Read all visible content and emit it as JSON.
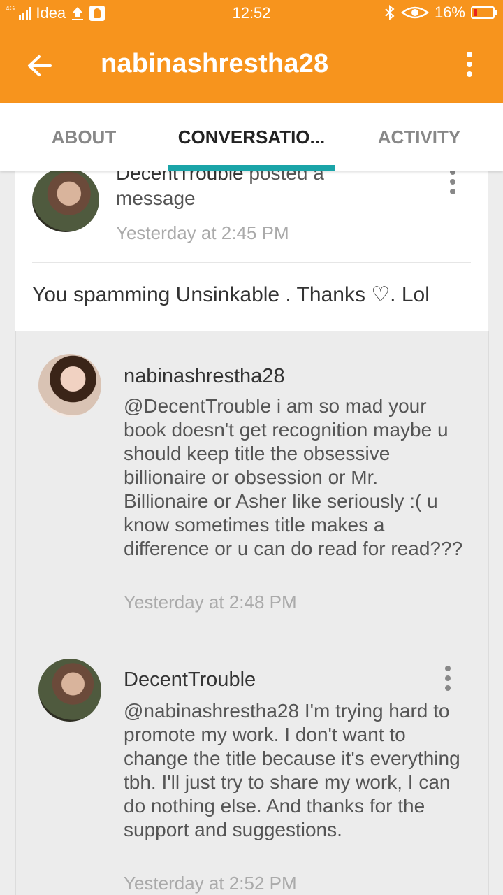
{
  "status_bar": {
    "network": "4G",
    "carrier": "Idea",
    "time": "12:52",
    "battery": "16%"
  },
  "app_bar": {
    "title": "nabinashrestha28"
  },
  "tabs": [
    {
      "label": "ABOUT",
      "active": false
    },
    {
      "label": "CONVERSATIO...",
      "active": true
    },
    {
      "label": "ACTIVITY",
      "active": false
    }
  ],
  "post": {
    "author": "DecentTrouble",
    "action": "posted a message",
    "timestamp": "Yesterday at 2:45 PM",
    "message": "You spamming Unsinkable . Thanks ♡. Lol"
  },
  "replies": [
    {
      "author": "nabinashrestha28",
      "body": "@DecentTrouble i am so mad your book doesn't get recognition maybe u should keep title the obsessive billionaire or obsession or Mr. Billionaire or Asher like seriously :( u know sometimes title makes a difference or u can do read for read???",
      "timestamp": "Yesterday at 2:48 PM"
    },
    {
      "author": "DecentTrouble",
      "body": "@nabinashrestha28 I'm trying hard to promote my work. I don't want to change the title because it's everything tbh. I'll just try to share my work, I can do nothing else. And thanks for the support and suggestions.",
      "timestamp": "Yesterday at 2:52 PM"
    }
  ],
  "colors": {
    "app_bar": "#f7941d",
    "tab_indicator": "#1aa4a8",
    "battery_low": "#e8231f"
  }
}
